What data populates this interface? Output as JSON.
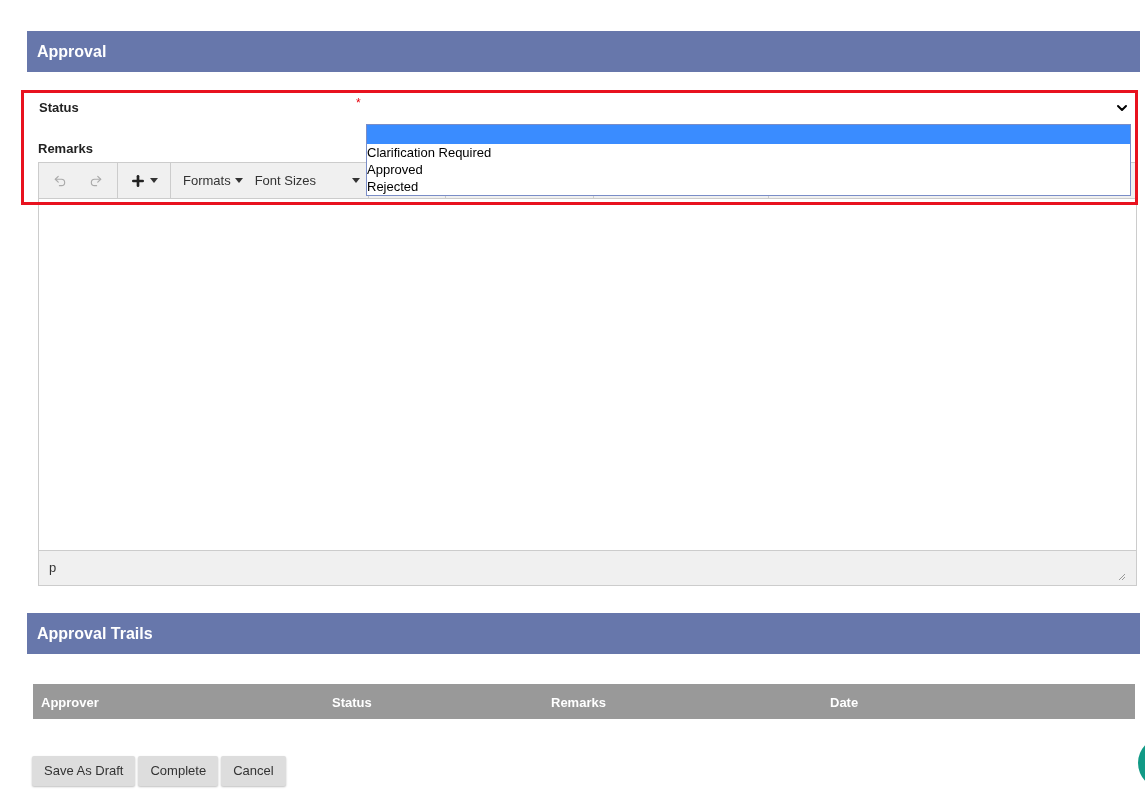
{
  "approval": {
    "title": "Approval",
    "status": {
      "label": "Status",
      "required_mark": "*",
      "expanded": true,
      "blank_option": {
        "selected": true
      },
      "options": [
        {
          "label": "Clarification Required",
          "selected": false
        },
        {
          "label": "Approved",
          "selected": false
        },
        {
          "label": "Rejected",
          "selected": false
        }
      ]
    },
    "remarks": {
      "label": "Remarks",
      "toolbar": {
        "undo_disabled": true,
        "redo_disabled": true,
        "menus": [
          "Formats",
          "Font Sizes"
        ]
      },
      "path": "p"
    }
  },
  "approval_trails": {
    "title": "Approval Trails",
    "columns": [
      "Approver",
      "Status",
      "Remarks",
      "Date"
    ]
  },
  "buttons": [
    "Save As Draft",
    "Complete",
    "Cancel"
  ]
}
